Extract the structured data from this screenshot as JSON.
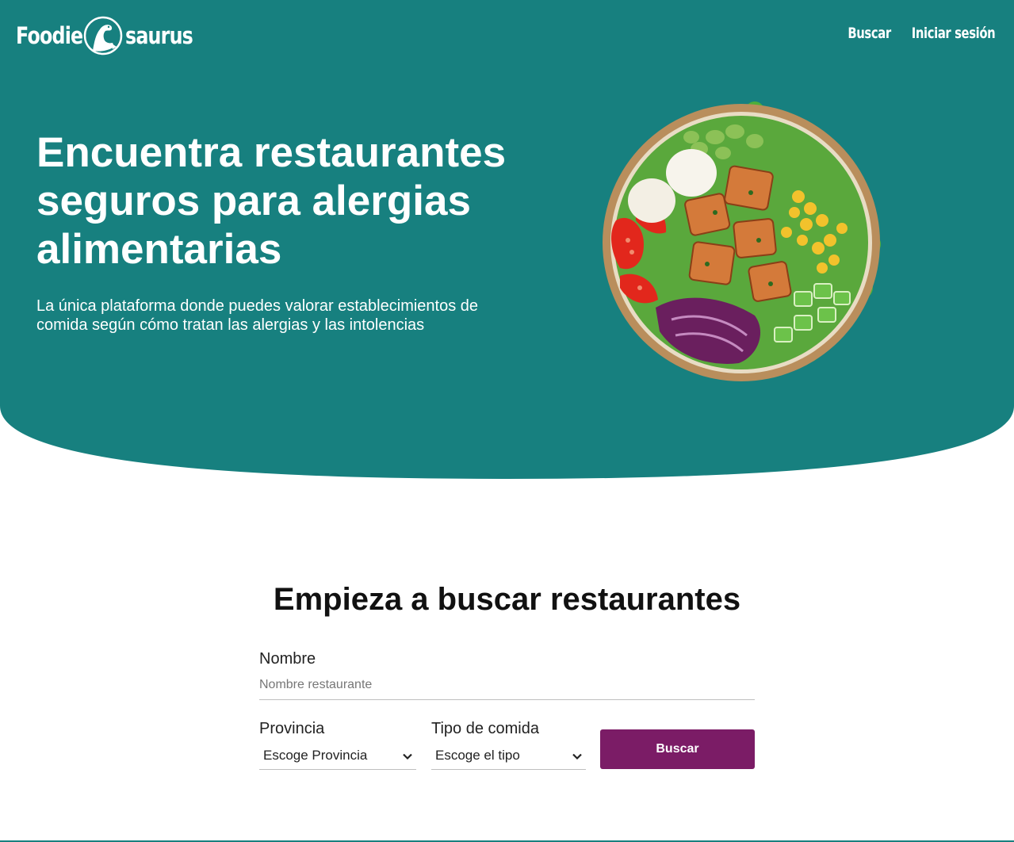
{
  "colors": {
    "brand_teal": "#17807f",
    "button_purple": "#7b1c66",
    "text_white": "#ffffff"
  },
  "header": {
    "logo_part1": "Foodie",
    "logo_part2": "saurus",
    "logo_icon": "dinosaur-icon",
    "nav": [
      {
        "label": "Buscar"
      },
      {
        "label": "Iniciar sesión"
      }
    ]
  },
  "hero": {
    "title": "Encuentra restaurantes seguros para alergias alimentarias",
    "subtitle": "La única plataforma donde puedes valorar establecimientos de comida según cómo tratan las alergias y las intolencias",
    "image": "salad-bowl-image"
  },
  "search": {
    "title": "Empieza a buscar restaurantes",
    "name_label": "Nombre",
    "name_placeholder": "Nombre restaurante",
    "province_label": "Provincia",
    "province_value": "Escoge Provincia",
    "food_label": "Tipo de comida",
    "food_value": "Escoge el tipo",
    "button_label": "Buscar"
  }
}
